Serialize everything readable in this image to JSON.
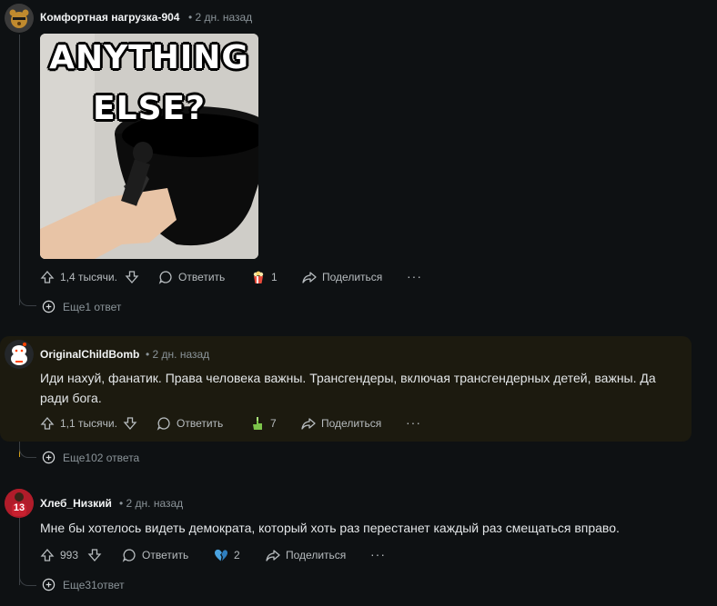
{
  "comments": [
    {
      "author": "Комфортная нагрузка-904",
      "time": "• 2 дн. назад",
      "image": {
        "caption_line1": "ANYTHING",
        "caption_line2": "ELSE?"
      },
      "upvotes": "1,4 тысячи.",
      "reply_label": "Ответить",
      "award_count": "1",
      "share_label": "Поделиться",
      "more_label": "···",
      "more_replies": "Еще1 ответ"
    },
    {
      "author": "OriginalChildBomb",
      "time": "• 2 дн. назад",
      "text": "Иди нахуй, фанатик. Права человека важны. Трансгендеры, включая трансгендерных детей, важны. Да ради бога.",
      "upvotes": "1,1 тысячи.",
      "reply_label": "Ответить",
      "award_count": "7",
      "share_label": "Поделиться",
      "more_label": "···",
      "more_replies": "Еще102 ответа"
    },
    {
      "author": "Хлеб_Низкий",
      "time": "• 2 дн. назад",
      "text": "Мне бы хотелось видеть демократа, который хоть раз перестанет каждый раз смещаться вправо.",
      "upvotes": "993",
      "reply_label": "Ответить",
      "award_count": "2",
      "share_label": "Поделиться",
      "more_label": "···",
      "more_replies": "Еще31ответ"
    }
  ],
  "avatar3_number": "13",
  "colors": {
    "background": "#0e1113",
    "highlight": "#1c1a0f",
    "highlight_line": "#d4a017"
  }
}
